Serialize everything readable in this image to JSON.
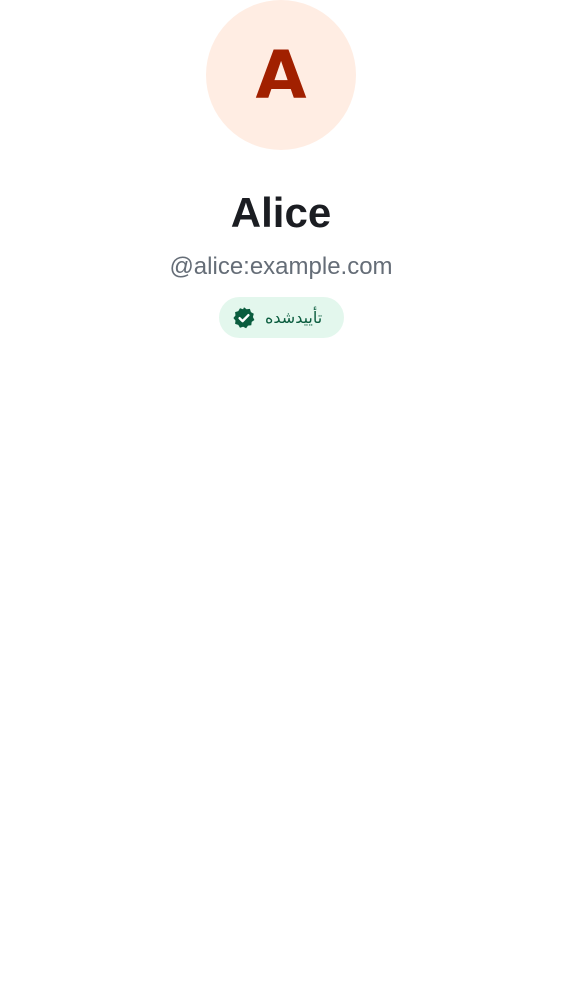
{
  "profile": {
    "avatar_letter": "A",
    "display_name": "Alice",
    "user_id": "@alice:example.com",
    "verification_badge": {
      "label": "تأییدشده",
      "icon": "verified-check-icon"
    }
  },
  "colors": {
    "avatar_background": "#ffede3",
    "avatar_letter": "#a12000",
    "name_text": "#1b1d22",
    "user_id_text": "#656d77",
    "badge_background": "#e3f7ed",
    "badge_accent": "#0a5c3e"
  }
}
